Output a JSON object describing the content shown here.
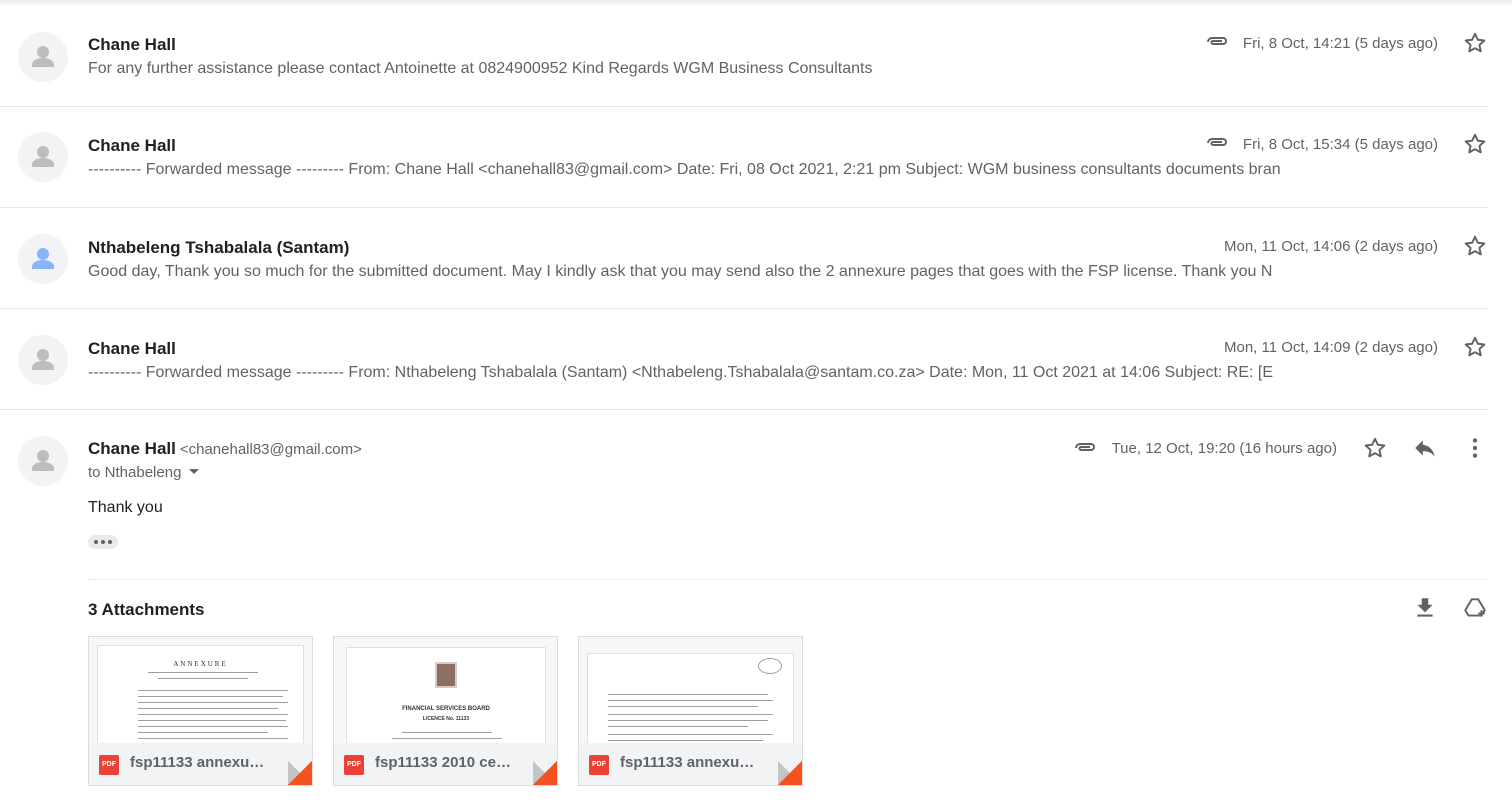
{
  "colors": {
    "accent_blue": "#8ab4f8",
    "pdf_red": "#ea4335",
    "corner_orange": "#f4511e",
    "muted": "#5f6368"
  },
  "messages": [
    {
      "sender": "Chane Hall",
      "snippet": "For any further assistance please contact Antoinette at 0824900952 Kind Regards WGM Business Consultants",
      "date": "Fri, 8 Oct, 14:21 (5 days ago)",
      "has_attachment": true,
      "avatar": "default-avatar-icon"
    },
    {
      "sender": "Chane Hall",
      "snippet": "---------- Forwarded message --------- From: Chane Hall <chanehall83@gmail.com> Date: Fri, 08 Oct 2021, 2:21 pm Subject: WGM business consultants documents bran",
      "date": "Fri, 8 Oct, 15:34 (5 days ago)",
      "has_attachment": true,
      "avatar": "default-avatar-icon"
    },
    {
      "sender": "Nthabeleng Tshabalala (Santam)",
      "snippet": "Good day, Thank you so much for the submitted document. May I kindly ask that you may send also the 2 annexure pages that goes with the FSP license. Thank you N",
      "date": "Mon, 11 Oct, 14:06 (2 days ago)",
      "has_attachment": false,
      "avatar": "blue-avatar-icon"
    },
    {
      "sender": "Chane Hall",
      "snippet": "---------- Forwarded message --------- From: Nthabeleng Tshabalala (Santam) <Nthabeleng.Tshabalala@santam.co.za> Date: Mon, 11 Oct 2021 at 14:06 Subject: RE: [E",
      "date": "Mon, 11 Oct, 14:09 (2 days ago)",
      "has_attachment": false,
      "avatar": "default-avatar-icon"
    }
  ],
  "open_message": {
    "sender": "Chane Hall",
    "email": "<chanehall83@gmail.com>",
    "to": "to Nthabeleng",
    "date": "Tue, 12 Oct, 19:20 (16 hours ago)",
    "body": "Thank you",
    "attachments_title": "3 Attachments",
    "attachments": [
      {
        "name": "fsp11133 annexure…",
        "type": "PDF"
      },
      {
        "name": "fsp11133 2010 cer…",
        "type": "PDF"
      },
      {
        "name": "fsp11133 annexure…",
        "type": "PDF"
      }
    ]
  },
  "thumb_text": {
    "annexure_heading": "ANNEXURE",
    "board_title": "FINANCIAL SERVICES BOARD",
    "licence_no": "LICENCE No. 11133"
  }
}
